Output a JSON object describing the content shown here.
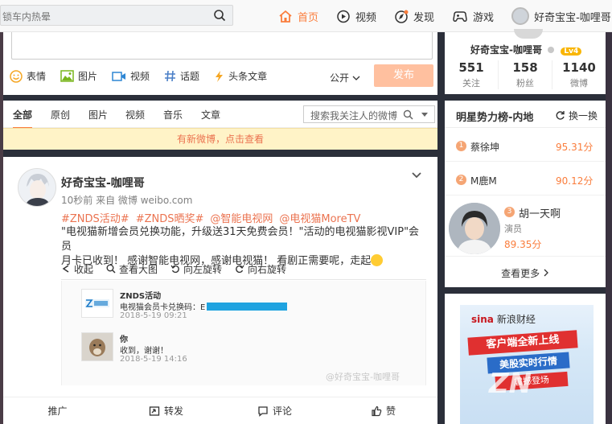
{
  "topbar": {
    "search_placeholder": "锁车内热晕",
    "nav": [
      {
        "label": "首页",
        "icon": "home-icon"
      },
      {
        "label": "视频",
        "icon": "video-icon"
      },
      {
        "label": "发现",
        "icon": "discover-icon"
      },
      {
        "label": "游戏",
        "icon": "game-icon"
      }
    ],
    "username": "好奇宝宝-咖哩哥"
  },
  "compose": {
    "tools": [
      {
        "label": "表情",
        "icon": "emoji-icon"
      },
      {
        "label": "图片",
        "icon": "image-icon"
      },
      {
        "label": "视频",
        "icon": "video-icon"
      },
      {
        "label": "话题",
        "icon": "hashtag-icon"
      },
      {
        "label": "头条文章",
        "icon": "article-icon"
      }
    ],
    "visibility": "公开",
    "publish": "发布"
  },
  "feed": {
    "tabs": [
      "全部",
      "原创",
      "图片",
      "视频",
      "音乐",
      "文章"
    ],
    "search_placeholder": "搜索我关注人的微博",
    "new_notice": "有新微博，点击查看"
  },
  "post": {
    "author": "好奇宝宝-咖哩哥",
    "meta": "10秒前 来自 微博 weibo.com",
    "tags": [
      "#ZNDS活动#",
      "#ZNDS晒奖#",
      "@智能电视网",
      "@电视猫MoreTV"
    ],
    "text_line1": "\"电视猫新增会员兑换功能，升级送31天免费会员！\"活动的电视猫影视VIP\"会员",
    "text_line2": "月卡已收到！ 感谢智能电视网，感谢电视猫！ 看剧正需要呢，走起",
    "actions": [
      "收起",
      "查看大图",
      "向左旋转",
      "向右旋转"
    ],
    "messages": [
      {
        "title": "ZNDS活动",
        "body": "电视猫会员卡兑换码：E",
        "date": "2018-5-19 09:21"
      },
      {
        "title": "你",
        "body": "收到，谢谢！",
        "date": "2018-5-19 14:16"
      }
    ],
    "watermark": "@好奇宝宝-咖哩哥",
    "bottom": [
      "推广",
      "转发",
      "评论",
      "赞"
    ]
  },
  "user_card": {
    "name": "好奇宝宝-咖哩哥",
    "level": "Lv4",
    "stats": [
      {
        "num": "551",
        "label": "关注"
      },
      {
        "num": "158",
        "label": "粉丝"
      },
      {
        "num": "1140",
        "label": "微博"
      }
    ]
  },
  "ranking": {
    "title": "明星势力榜-内地",
    "switch": "换一换",
    "items": [
      {
        "rank": "1",
        "name": "蔡徐坤",
        "score": "95.31分"
      },
      {
        "rank": "2",
        "name": "M鹿M",
        "score": "90.12分"
      }
    ],
    "third": {
      "rank": "3",
      "name": "胡一天啊",
      "role": "演员",
      "score": "89.35分"
    },
    "more": "查看更多"
  },
  "ad": {
    "logo": "sina",
    "logo_sub": "新浪财经",
    "line1": "客户端全新上线",
    "line2": "美股实时行情",
    "line3": "震撼登场",
    "watermark": "ZN"
  },
  "colors": {
    "accent": "#fa7d3c",
    "link": "#eb7350",
    "publish_disabled": "#ffc09f"
  }
}
